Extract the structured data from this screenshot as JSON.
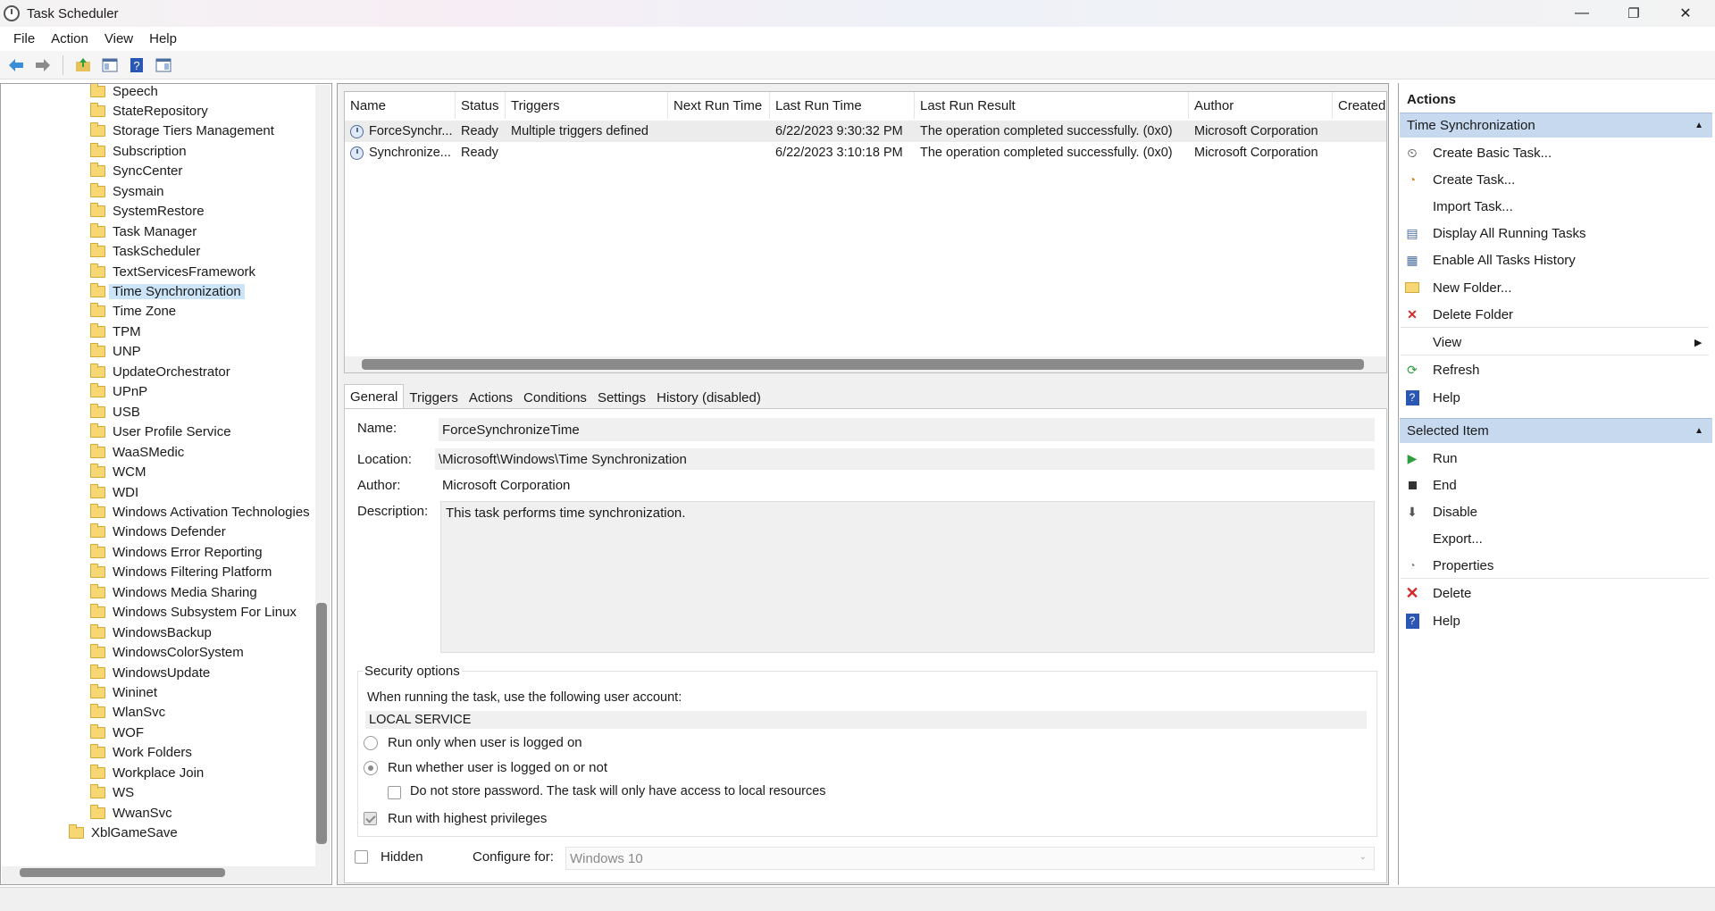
{
  "window": {
    "title": "Task Scheduler",
    "minimize": "—",
    "restore": "❐",
    "close": "✕"
  },
  "menu": [
    "File",
    "Action",
    "View",
    "Help"
  ],
  "tree": {
    "items": [
      "Speech",
      "StateRepository",
      "Storage Tiers Management",
      "Subscription",
      "SyncCenter",
      "Sysmain",
      "SystemRestore",
      "Task Manager",
      "TaskScheduler",
      "TextServicesFramework",
      "Time Synchronization",
      "Time Zone",
      "TPM",
      "UNP",
      "UpdateOrchestrator",
      "UPnP",
      "USB",
      "User Profile Service",
      "WaaSMedic",
      "WCM",
      "WDI",
      "Windows Activation Technologies",
      "Windows Defender",
      "Windows Error Reporting",
      "Windows Filtering Platform",
      "Windows Media Sharing",
      "Windows Subsystem For Linux",
      "WindowsBackup",
      "WindowsColorSystem",
      "WindowsUpdate",
      "Wininet",
      "WlanSvc",
      "WOF",
      "Work Folders",
      "Workplace Join",
      "WS",
      "WwanSvc"
    ],
    "selected": "Time Synchronization",
    "parent_item": "XblGameSave"
  },
  "tasklist": {
    "columns": [
      "Name",
      "Status",
      "Triggers",
      "Next Run Time",
      "Last Run Time",
      "Last Run Result",
      "Author",
      "Created"
    ],
    "rows": [
      {
        "name": "ForceSynchr...",
        "status": "Ready",
        "triggers": "Multiple triggers defined",
        "next": "",
        "last": "6/22/2023 9:30:32 PM",
        "result": "The operation completed successfully. (0x0)",
        "author": "Microsoft Corporation",
        "created": ""
      },
      {
        "name": "Synchronize...",
        "status": "Ready",
        "triggers": "",
        "next": "",
        "last": "6/22/2023 3:10:18 PM",
        "result": "The operation completed successfully. (0x0)",
        "author": "Microsoft Corporation",
        "created": ""
      }
    ]
  },
  "tabs": [
    "General",
    "Triggers",
    "Actions",
    "Conditions",
    "Settings",
    "History (disabled)"
  ],
  "general": {
    "name_label": "Name:",
    "name_value": "ForceSynchronizeTime",
    "location_label": "Location:",
    "location_value": "\\Microsoft\\Windows\\Time Synchronization",
    "author_label": "Author:",
    "author_value": "Microsoft Corporation",
    "description_label": "Description:",
    "description_value": "This task performs time synchronization.",
    "security_title": "Security options",
    "account_prompt": "When running the task, use the following user account:",
    "account_value": "LOCAL SERVICE",
    "radio1": "Run only when user is logged on",
    "radio2": "Run whether user is logged on or not",
    "no_store_pw": "Do not store password.  The task will only have access to local resources",
    "highest": "Run with highest privileges",
    "hidden": "Hidden",
    "configure_label": "Configure for:",
    "configure_value": "Windows 10"
  },
  "actions": {
    "title": "Actions",
    "section1": "Time Synchronization",
    "section1_items": [
      "Create Basic Task...",
      "Create Task...",
      "Import Task...",
      "Display All Running Tasks",
      "Enable All Tasks History",
      "New Folder...",
      "Delete Folder",
      "View",
      "Refresh",
      "Help"
    ],
    "section2": "Selected Item",
    "section2_items": [
      "Run",
      "End",
      "Disable",
      "Export...",
      "Properties",
      "Delete",
      "Help"
    ]
  },
  "colors": {
    "selection": "#cce4f7",
    "section_header": "#c6d9ee",
    "delete_red": "#d42a2a",
    "run_green": "#2e9e3e",
    "help_blue": "#2a56b4"
  }
}
